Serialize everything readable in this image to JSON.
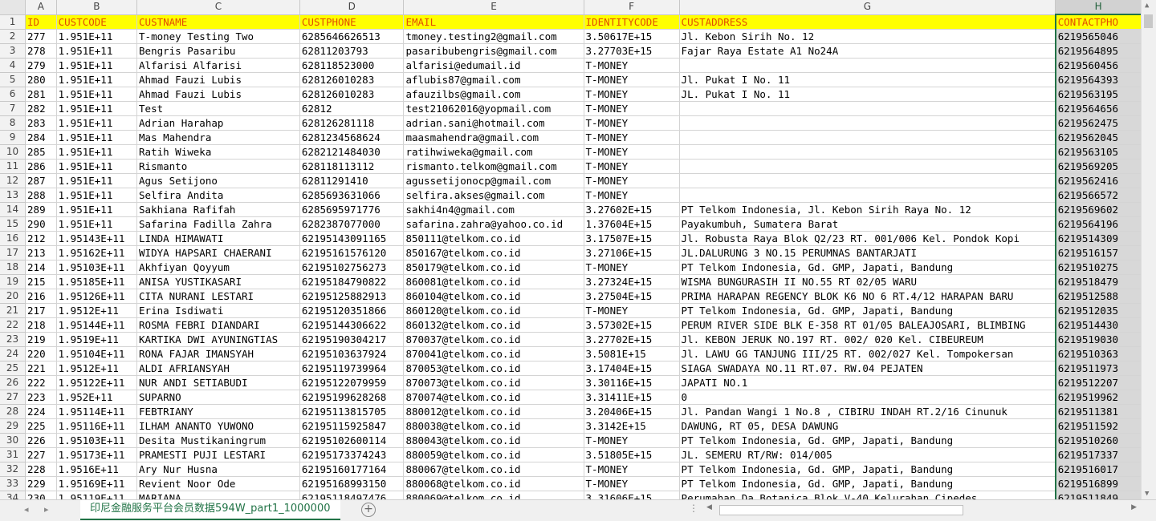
{
  "columns": [
    "A",
    "B",
    "C",
    "D",
    "E",
    "F",
    "G",
    "H"
  ],
  "selected_column": "H",
  "headers": [
    "ID",
    "CUSTCODE",
    "CUSTNAME",
    "CUSTPHONE",
    "EMAIL",
    "IDENTITYCODE",
    "CUSTADDRESS",
    "CONTACTPHO"
  ],
  "rows": [
    [
      "277",
      "1.951E+11",
      "T-money Testing Two",
      "6285646626513",
      "tmoney.testing2@gmail.com",
      "3.50617E+15",
      "Jl. Kebon Sirih No. 12",
      "6219565046"
    ],
    [
      "278",
      "1.951E+11",
      "Bengris Pasaribu",
      "62811203793",
      "pasaribubengris@gmail.com",
      "3.27703E+15",
      "Fajar Raya Estate A1 No24A",
      "6219564895"
    ],
    [
      "279",
      "1.951E+11",
      "Alfarisi Alfarisi",
      "628118523000",
      "alfarisi@edumail.id",
      "T-MONEY",
      "",
      "6219560456"
    ],
    [
      "280",
      "1.951E+11",
      "Ahmad Fauzi Lubis",
      "628126010283",
      "aflubis87@gmail.com",
      "T-MONEY",
      "Jl. Pukat I No. 11",
      "6219564393"
    ],
    [
      "281",
      "1.951E+11",
      "Ahmad Fauzi Lubis",
      "628126010283",
      "afauzilbs@gmail.com",
      "T-MONEY",
      "JL. Pukat I No. 11",
      "6219563195"
    ],
    [
      "282",
      "1.951E+11",
      "Test",
      "62812",
      "test21062016@yopmail.com",
      "T-MONEY",
      "",
      "6219564656"
    ],
    [
      "283",
      "1.951E+11",
      "Adrian Harahap",
      "628126281118",
      "adrian.sani@hotmail.com",
      "T-MONEY",
      "",
      "6219562475"
    ],
    [
      "284",
      "1.951E+11",
      "Mas Mahendra",
      "6281234568624",
      "maasmahendra@gmail.com",
      "T-MONEY",
      "",
      "6219562045"
    ],
    [
      "285",
      "1.951E+11",
      "Ratih Wiweka",
      "6282121484030",
      "ratihwiweka@gmail.com",
      "T-MONEY",
      "",
      "6219563105"
    ],
    [
      "286",
      "1.951E+11",
      "Rismanto",
      "628118113112",
      "rismanto.telkom@gmail.com",
      "T-MONEY",
      "",
      "6219569205"
    ],
    [
      "287",
      "1.951E+11",
      "Agus Setijono",
      "62811291410",
      "agussetijonocp@gmail.com",
      "T-MONEY",
      "",
      "6219562416"
    ],
    [
      "288",
      "1.951E+11",
      "Selfira Andita",
      "6285693631066",
      "selfira.akses@gmail.com",
      "T-MONEY",
      "",
      "6219566572"
    ],
    [
      "289",
      "1.951E+11",
      "Sakhiana Rafifah",
      "6285695971776",
      "sakhi4n4@gmail.com",
      "3.27602E+15",
      "PT Telkom Indonesia, Jl. Kebon Sirih Raya No. 12",
      "6219569602"
    ],
    [
      "290",
      "1.951E+11",
      "Safarina Fadilla Zahra",
      "6282387077000",
      "safarina.zahra@yahoo.co.id",
      "1.37604E+15",
      "Payakumbuh, Sumatera Barat",
      "6219564196"
    ],
    [
      "212",
      "1.95143E+11",
      "LINDA HIMAWATI",
      "62195143091165",
      "850111@telkom.co.id",
      "3.17507E+15",
      "Jl. Robusta Raya Blok Q2/23 RT. 001/006 Kel. Pondok Kopi",
      "6219514309"
    ],
    [
      "213",
      "1.95162E+11",
      "WIDYA HAPSARI CHAERANI",
      "62195161576120",
      "850167@telkom.co.id",
      "3.27106E+15",
      "JL.DALURUNG 3 NO.15 PERUMNAS BANTARJATI",
      "6219516157"
    ],
    [
      "214",
      "1.95103E+11",
      "Akhfiyan Qoyyum",
      "62195102756273",
      "850179@telkom.co.id",
      "T-MONEY",
      "PT Telkom Indonesia, Gd. GMP, Japati, Bandung",
      "6219510275"
    ],
    [
      "215",
      "1.95185E+11",
      "ANISA YUSTIKASARI",
      "62195184790822",
      "860081@telkom.co.id",
      "3.27324E+15",
      "WISMA BUNGURASIH II NO.55 RT 02/05 WARU",
      "6219518479"
    ],
    [
      "216",
      "1.95126E+11",
      "CITA NURANI LESTARI",
      "62195125882913",
      "860104@telkom.co.id",
      "3.27504E+15",
      "PRIMA HARAPAN REGENCY BLOK K6 NO 6 RT.4/12 HARAPAN BARU",
      "6219512588"
    ],
    [
      "217",
      "1.9512E+11",
      "Erina Isdiwati",
      "62195120351866",
      "860120@telkom.co.id",
      "T-MONEY",
      "PT Telkom Indonesia, Gd. GMP, Japati, Bandung",
      "6219512035"
    ],
    [
      "218",
      "1.95144E+11",
      "ROSMA FEBRI DIANDARI",
      "62195144306622",
      "860132@telkom.co.id",
      "3.57302E+15",
      "PERUM RIVER SIDE BLK E-358 RT 01/05 BALEAJOSARI, BLIMBING",
      "6219514430"
    ],
    [
      "219",
      "1.9519E+11",
      "KARTIKA DWI AYUNINGTIAS",
      "62195190304217",
      "870037@telkom.co.id",
      "3.27702E+15",
      "Jl. KEBON JERUK NO.197 RT. 002/ 020 Kel. CIBEUREUM",
      "6219519030"
    ],
    [
      "220",
      "1.95104E+11",
      "RONA FAJAR IMANSYAH",
      "62195103637924",
      "870041@telkom.co.id",
      "3.5081E+15",
      "Jl. LAWU GG TANJUNG III/25 RT. 002/027 Kel. Tompokersan",
      "6219510363"
    ],
    [
      "221",
      "1.9512E+11",
      "ALDI AFRIANSYAH",
      "62195119739964",
      "870053@telkom.co.id",
      "3.17404E+15",
      "SIAGA SWADAYA NO.11 RT.07. RW.04 PEJATEN",
      "6219511973"
    ],
    [
      "222",
      "1.95122E+11",
      "NUR ANDI SETIABUDI",
      "62195122079959",
      "870073@telkom.co.id",
      "3.30116E+15",
      "JAPATI NO.1",
      "6219512207"
    ],
    [
      "223",
      "1.952E+11",
      "SUPARNO",
      "62195199628268",
      "870074@telkom.co.id",
      "3.31411E+15",
      "0",
      "6219519962"
    ],
    [
      "224",
      "1.95114E+11",
      "FEBTRIANY",
      "62195113815705",
      "880012@telkom.co.id",
      "3.20406E+15",
      "Jl. Pandan Wangi 1 No.8 , CIBIRU INDAH RT.2/16 Cinunuk",
      "6219511381"
    ],
    [
      "225",
      "1.95116E+11",
      "ILHAM ANANTO YUWONO",
      "62195115925847",
      "880038@telkom.co.id",
      "3.3142E+15",
      "DAWUNG, RT 05, DESA DAWUNG",
      "6219511592"
    ],
    [
      "226",
      "1.95103E+11",
      "Desita Mustikaningrum",
      "62195102600114",
      "880043@telkom.co.id",
      "T-MONEY",
      "PT Telkom Indonesia, Gd. GMP, Japati, Bandung",
      "6219510260"
    ],
    [
      "227",
      "1.95173E+11",
      "PRAMESTI PUJI LESTARI",
      "62195173374243",
      "880059@telkom.co.id",
      "3.51805E+15",
      "JL. SEMERU RT/RW: 014/005",
      "6219517337"
    ],
    [
      "228",
      "1.9516E+11",
      "Ary Nur Husna",
      "62195160177164",
      "880067@telkom.co.id",
      "T-MONEY",
      "PT Telkom Indonesia, Gd. GMP, Japati, Bandung",
      "6219516017"
    ],
    [
      "229",
      "1.95169E+11",
      "Revient Noor Ode",
      "62195168993150",
      "880068@telkom.co.id",
      "T-MONEY",
      "PT Telkom Indonesia, Gd. GMP, Japati, Bandung",
      "6219516899"
    ],
    [
      "230",
      "1.95119E+11",
      "MARIANA",
      "62195118497476",
      "880069@telkom.co.id",
      "3.31606E+15",
      "Perumahan Da Botanica Blok V-40 Kelurahan Cipedes",
      "6219511849"
    ]
  ],
  "sheet_tab": "印尼金融服务平台会员数据594W_part1_1000000",
  "icons": {
    "first": "◂",
    "last": "▸",
    "add": "+",
    "dots": "⋮",
    "scroll_up": "▲",
    "scroll_down": "▼",
    "scroll_left": "◀",
    "scroll_right": "▶"
  },
  "colors": {
    "header_fill": "#ffff00",
    "header_text": "#e34c00",
    "accent": "#217346"
  }
}
